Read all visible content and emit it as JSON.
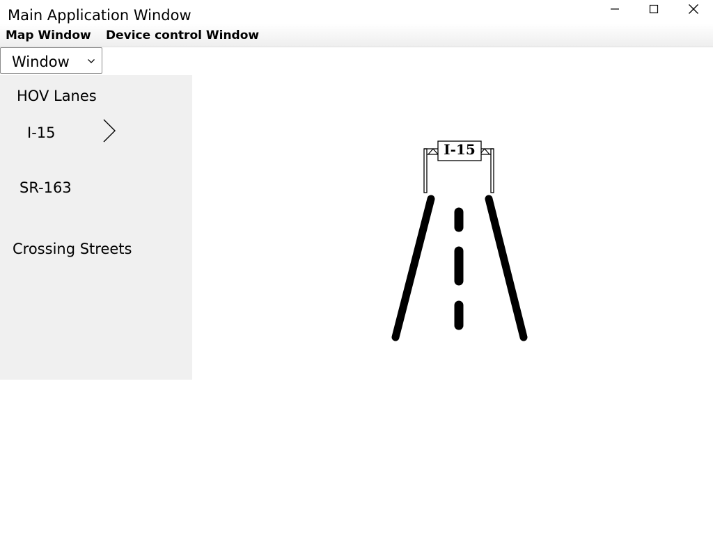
{
  "window": {
    "title": "Main Application Window",
    "controls": [
      "minimize-icon",
      "maximize-icon",
      "close-icon"
    ]
  },
  "menubar": {
    "map_window": "Map Window",
    "device_control_window": "Device control Window"
  },
  "window_select": {
    "selected": "Window",
    "icon": "chevron-down-icon"
  },
  "sidebar": {
    "heading": "HOV Lanes",
    "items": [
      {
        "label": "I-15",
        "icon": "chevron-right-icon"
      },
      {
        "label": "SR-163"
      }
    ],
    "crossing_streets": "Crossing Streets"
  },
  "map": {
    "sign_text": "I-15"
  },
  "colors": {
    "sidebar_bg": "#f0f0f0",
    "road_lines": "#000000",
    "background": "#ffffff"
  }
}
